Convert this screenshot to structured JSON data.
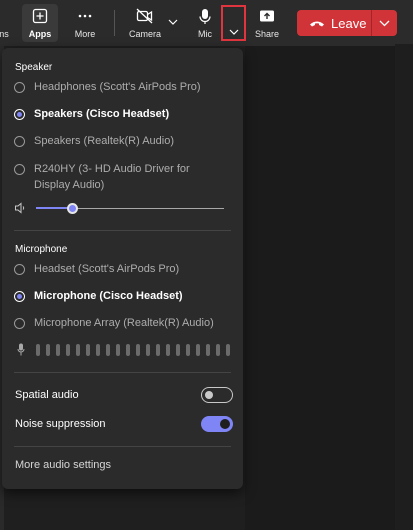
{
  "toolbar": {
    "cut_label": "ns",
    "apps_label": "Apps",
    "more_label": "More",
    "camera_label": "Camera",
    "mic_label": "Mic",
    "share_label": "Share",
    "leave_label": "Leave"
  },
  "panel": {
    "speaker_title": "Speaker",
    "speakers": [
      {
        "label": "Headphones (Scott's AirPods Pro)",
        "selected": false
      },
      {
        "label": "Speakers (Cisco Headset)",
        "selected": true
      },
      {
        "label": "Speakers (Realtek(R) Audio)",
        "selected": false
      },
      {
        "label": "R240HY (3- HD Audio Driver for Display Audio)",
        "selected": false
      }
    ],
    "speaker_volume": 0.2,
    "microphone_title": "Microphone",
    "microphones": [
      {
        "label": "Headset (Scott's AirPods Pro)",
        "selected": false
      },
      {
        "label": "Microphone (Cisco Headset)",
        "selected": true
      },
      {
        "label": "Microphone Array (Realtek(R) Audio)",
        "selected": false
      }
    ],
    "spatial_audio_label": "Spatial audio",
    "spatial_audio_on": false,
    "noise_suppression_label": "Noise suppression",
    "noise_suppression_on": true,
    "more_settings_label": "More audio settings"
  },
  "colors": {
    "accent": "#7f85f5",
    "leave": "#d13438",
    "highlight_border": "#e0353f"
  }
}
